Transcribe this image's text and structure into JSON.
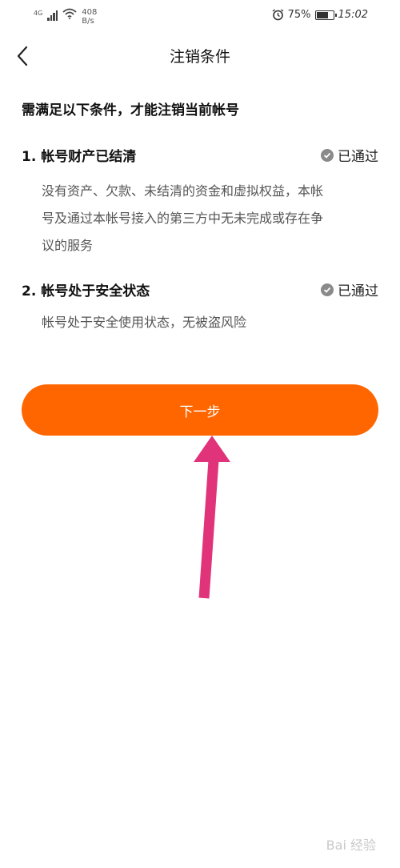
{
  "status_bar": {
    "network_type": "4G",
    "speed_value": "408",
    "speed_unit": "B/s",
    "battery": "75%",
    "battery_level": 0.75,
    "time": "15:02"
  },
  "header": {
    "title": "注销条件"
  },
  "heading": "需满足以下条件，才能注销当前帐号",
  "conditions": [
    {
      "title": "1. 帐号财产已结清",
      "status": "已通过",
      "desc_lines": [
        "没有资产、欠款、未结清的资金和虚拟权益，本帐",
        "号及通过本帐号接入的第三方中无未完成或存在争",
        "议的服务"
      ]
    },
    {
      "title": "2. 帐号处于安全状态",
      "status": "已通过",
      "desc_lines": [
        "帐号处于安全使用状态，无被盗风险"
      ]
    }
  ],
  "next_button": "下一步",
  "watermark": "Bai 经验",
  "colors": {
    "accent": "#ff6600",
    "annotation_arrow": "#e0337a",
    "check_badge": "#8a8a8a"
  },
  "icons": {
    "back": "chevron-left-icon",
    "status": "check-circle-icon",
    "alarm": "alarm-icon",
    "wifi": "wifi-icon"
  }
}
